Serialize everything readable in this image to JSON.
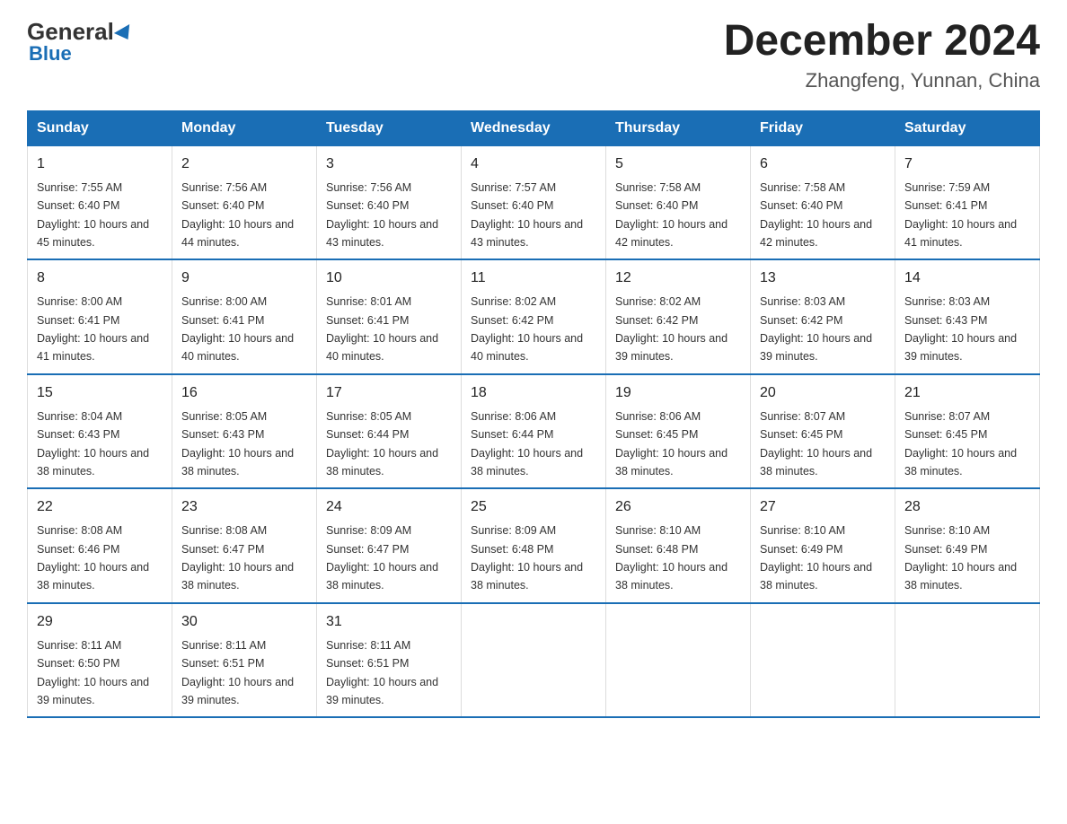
{
  "logo": {
    "general_text": "General",
    "blue_text": "Blue"
  },
  "title": "December 2024",
  "location": "Zhangfeng, Yunnan, China",
  "weekdays": [
    "Sunday",
    "Monday",
    "Tuesday",
    "Wednesday",
    "Thursday",
    "Friday",
    "Saturday"
  ],
  "weeks": [
    [
      {
        "day": "1",
        "sunrise": "7:55 AM",
        "sunset": "6:40 PM",
        "daylight": "10 hours and 45 minutes."
      },
      {
        "day": "2",
        "sunrise": "7:56 AM",
        "sunset": "6:40 PM",
        "daylight": "10 hours and 44 minutes."
      },
      {
        "day": "3",
        "sunrise": "7:56 AM",
        "sunset": "6:40 PM",
        "daylight": "10 hours and 43 minutes."
      },
      {
        "day": "4",
        "sunrise": "7:57 AM",
        "sunset": "6:40 PM",
        "daylight": "10 hours and 43 minutes."
      },
      {
        "day": "5",
        "sunrise": "7:58 AM",
        "sunset": "6:40 PM",
        "daylight": "10 hours and 42 minutes."
      },
      {
        "day": "6",
        "sunrise": "7:58 AM",
        "sunset": "6:40 PM",
        "daylight": "10 hours and 42 minutes."
      },
      {
        "day": "7",
        "sunrise": "7:59 AM",
        "sunset": "6:41 PM",
        "daylight": "10 hours and 41 minutes."
      }
    ],
    [
      {
        "day": "8",
        "sunrise": "8:00 AM",
        "sunset": "6:41 PM",
        "daylight": "10 hours and 41 minutes."
      },
      {
        "day": "9",
        "sunrise": "8:00 AM",
        "sunset": "6:41 PM",
        "daylight": "10 hours and 40 minutes."
      },
      {
        "day": "10",
        "sunrise": "8:01 AM",
        "sunset": "6:41 PM",
        "daylight": "10 hours and 40 minutes."
      },
      {
        "day": "11",
        "sunrise": "8:02 AM",
        "sunset": "6:42 PM",
        "daylight": "10 hours and 40 minutes."
      },
      {
        "day": "12",
        "sunrise": "8:02 AM",
        "sunset": "6:42 PM",
        "daylight": "10 hours and 39 minutes."
      },
      {
        "day": "13",
        "sunrise": "8:03 AM",
        "sunset": "6:42 PM",
        "daylight": "10 hours and 39 minutes."
      },
      {
        "day": "14",
        "sunrise": "8:03 AM",
        "sunset": "6:43 PM",
        "daylight": "10 hours and 39 minutes."
      }
    ],
    [
      {
        "day": "15",
        "sunrise": "8:04 AM",
        "sunset": "6:43 PM",
        "daylight": "10 hours and 38 minutes."
      },
      {
        "day": "16",
        "sunrise": "8:05 AM",
        "sunset": "6:43 PM",
        "daylight": "10 hours and 38 minutes."
      },
      {
        "day": "17",
        "sunrise": "8:05 AM",
        "sunset": "6:44 PM",
        "daylight": "10 hours and 38 minutes."
      },
      {
        "day": "18",
        "sunrise": "8:06 AM",
        "sunset": "6:44 PM",
        "daylight": "10 hours and 38 minutes."
      },
      {
        "day": "19",
        "sunrise": "8:06 AM",
        "sunset": "6:45 PM",
        "daylight": "10 hours and 38 minutes."
      },
      {
        "day": "20",
        "sunrise": "8:07 AM",
        "sunset": "6:45 PM",
        "daylight": "10 hours and 38 minutes."
      },
      {
        "day": "21",
        "sunrise": "8:07 AM",
        "sunset": "6:45 PM",
        "daylight": "10 hours and 38 minutes."
      }
    ],
    [
      {
        "day": "22",
        "sunrise": "8:08 AM",
        "sunset": "6:46 PM",
        "daylight": "10 hours and 38 minutes."
      },
      {
        "day": "23",
        "sunrise": "8:08 AM",
        "sunset": "6:47 PM",
        "daylight": "10 hours and 38 minutes."
      },
      {
        "day": "24",
        "sunrise": "8:09 AM",
        "sunset": "6:47 PM",
        "daylight": "10 hours and 38 minutes."
      },
      {
        "day": "25",
        "sunrise": "8:09 AM",
        "sunset": "6:48 PM",
        "daylight": "10 hours and 38 minutes."
      },
      {
        "day": "26",
        "sunrise": "8:10 AM",
        "sunset": "6:48 PM",
        "daylight": "10 hours and 38 minutes."
      },
      {
        "day": "27",
        "sunrise": "8:10 AM",
        "sunset": "6:49 PM",
        "daylight": "10 hours and 38 minutes."
      },
      {
        "day": "28",
        "sunrise": "8:10 AM",
        "sunset": "6:49 PM",
        "daylight": "10 hours and 38 minutes."
      }
    ],
    [
      {
        "day": "29",
        "sunrise": "8:11 AM",
        "sunset": "6:50 PM",
        "daylight": "10 hours and 39 minutes."
      },
      {
        "day": "30",
        "sunrise": "8:11 AM",
        "sunset": "6:51 PM",
        "daylight": "10 hours and 39 minutes."
      },
      {
        "day": "31",
        "sunrise": "8:11 AM",
        "sunset": "6:51 PM",
        "daylight": "10 hours and 39 minutes."
      },
      null,
      null,
      null,
      null
    ]
  ],
  "sunrise_label": "Sunrise: ",
  "sunset_label": "Sunset: ",
  "daylight_label": "Daylight: "
}
